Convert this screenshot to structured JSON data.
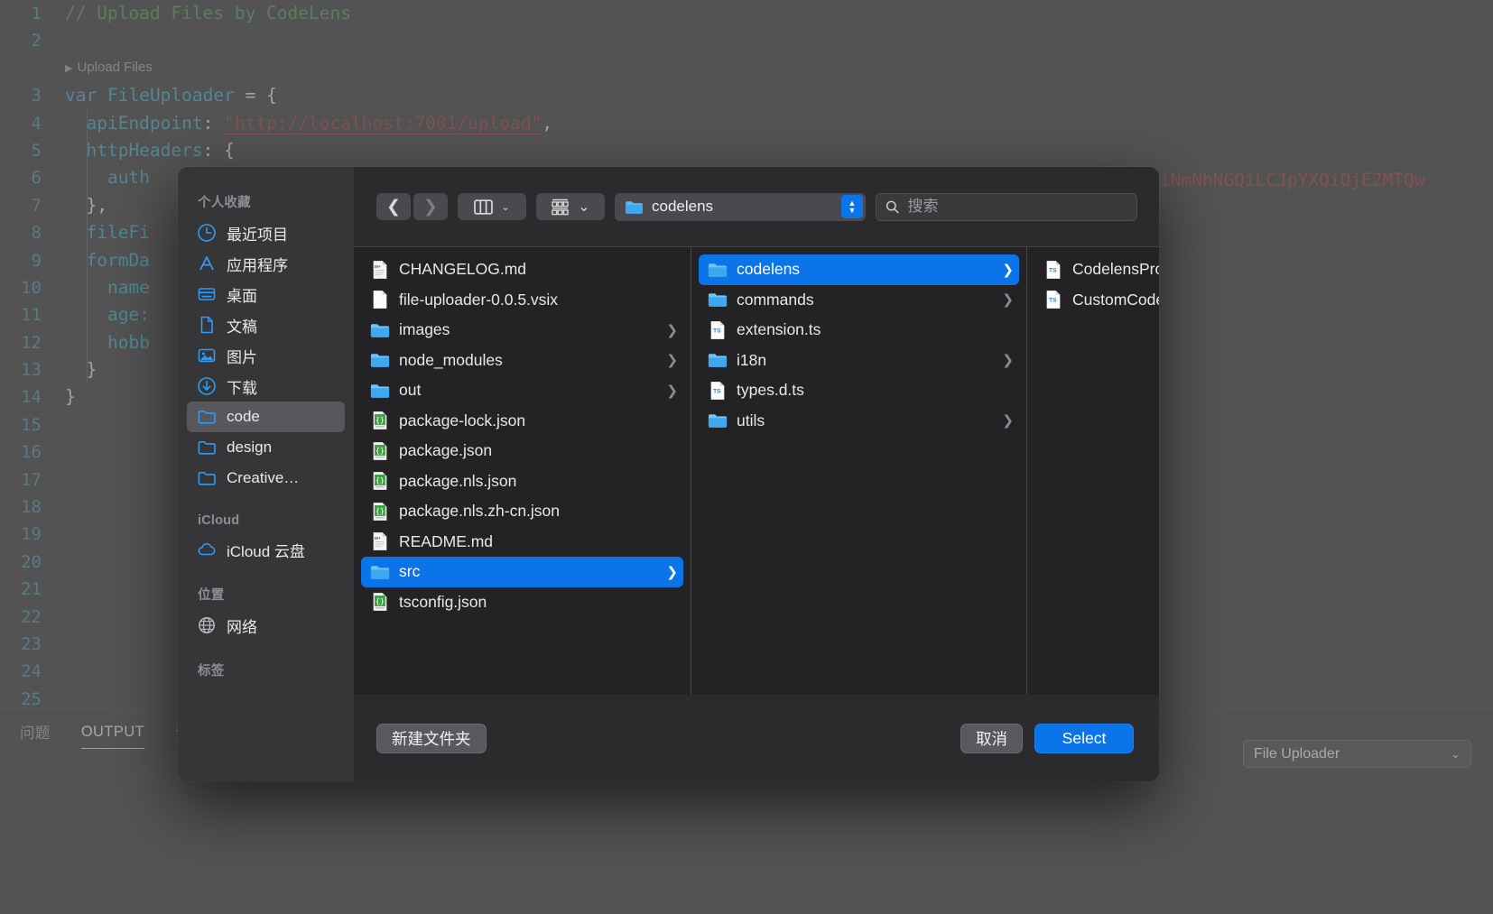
{
  "editor": {
    "lines": [
      {
        "num": "1",
        "kind": "comment",
        "text": "// Upload Files by CodeLens"
      },
      {
        "num": "2",
        "kind": "blank",
        "text": ""
      },
      {
        "num": "",
        "kind": "codelens",
        "text": "Upload Files"
      },
      {
        "num": "3",
        "kind": "code",
        "text": "var FileUploader = {"
      },
      {
        "num": "4",
        "kind": "code",
        "text": "  apiEndpoint: \"http://localhost:7001/upload\","
      },
      {
        "num": "5",
        "kind": "code",
        "text": "  httpHeaders: {"
      },
      {
        "num": "6",
        "kind": "code",
        "text": "    auth"
      },
      {
        "num": "7",
        "kind": "code",
        "text": "  },"
      },
      {
        "num": "8",
        "kind": "code",
        "text": "  fileFi"
      },
      {
        "num": "9",
        "kind": "code",
        "text": "  formDa"
      },
      {
        "num": "10",
        "kind": "code",
        "text": "    name"
      },
      {
        "num": "11",
        "kind": "code",
        "text": "    age:"
      },
      {
        "num": "12",
        "kind": "code",
        "text": "    hobb"
      },
      {
        "num": "13",
        "kind": "code",
        "text": "  }"
      },
      {
        "num": "14",
        "kind": "code",
        "text": "}"
      },
      {
        "num": "15",
        "kind": "blank",
        "text": ""
      },
      {
        "num": "16",
        "kind": "blank",
        "text": ""
      },
      {
        "num": "17",
        "kind": "blank",
        "text": ""
      },
      {
        "num": "18",
        "kind": "blank",
        "text": ""
      },
      {
        "num": "19",
        "kind": "blank",
        "text": ""
      },
      {
        "num": "20",
        "kind": "blank",
        "text": ""
      },
      {
        "num": "21",
        "kind": "blank",
        "text": ""
      },
      {
        "num": "22",
        "kind": "blank",
        "text": ""
      },
      {
        "num": "23",
        "kind": "blank",
        "text": ""
      },
      {
        "num": "24",
        "kind": "blank",
        "text": ""
      },
      {
        "num": "25",
        "kind": "blank",
        "text": ""
      }
    ],
    "codelens_label": "Upload Files",
    "comment_line": "// Upload Files by CodeLens",
    "line3": {
      "kw": "var",
      "name": "FileUploader",
      "rest": " = {"
    },
    "line4": {
      "prop": "  apiEndpoint",
      "sep": ": ",
      "value": "\"http://localhost:7001/upload\"",
      "tail": ","
    },
    "line5": {
      "prop": "  httpHeaders",
      "rest": ": {"
    },
    "line6": {
      "prop": "    auth"
    },
    "line7": {
      "rest": "  },"
    },
    "line8": {
      "prop": "  fileFi"
    },
    "line9": {
      "prop": "  formDa"
    },
    "line10": {
      "prop": "    name"
    },
    "line11": {
      "prop": "    age:"
    },
    "line12": {
      "prop": "    hobb"
    },
    "line13": {
      "rest": "  }"
    },
    "line14": {
      "rest": "}"
    },
    "overflow_string": "iNmNhNGQiLCJpYXQiOjE2MTQw"
  },
  "panel": {
    "tabs": [
      {
        "label": "问题",
        "active": false
      },
      {
        "label": "OUTPUT",
        "active": true
      },
      {
        "label": "调",
        "active": false
      }
    ],
    "output_channel": "File Uploader",
    "chevron": "⌄"
  },
  "dialog": {
    "sidebar": {
      "sections": [
        {
          "title": "个人收藏",
          "items": [
            {
              "label": "最近项目",
              "icon": "clock-icon",
              "selected": false
            },
            {
              "label": "应用程序",
              "icon": "apps-icon",
              "selected": false
            },
            {
              "label": "桌面",
              "icon": "desktop-icon",
              "selected": false
            },
            {
              "label": "文稿",
              "icon": "document-icon",
              "selected": false
            },
            {
              "label": "图片",
              "icon": "pictures-icon",
              "selected": false
            },
            {
              "label": "下载",
              "icon": "download-icon",
              "selected": false
            },
            {
              "label": "code",
              "icon": "folder-icon",
              "selected": true
            },
            {
              "label": "design",
              "icon": "folder-icon",
              "selected": false
            },
            {
              "label": "Creative…",
              "icon": "folder-icon",
              "selected": false
            }
          ]
        },
        {
          "title": "iCloud",
          "items": [
            {
              "label": "iCloud 云盘",
              "icon": "cloud-icon",
              "selected": false
            }
          ]
        },
        {
          "title": "位置",
          "items": [
            {
              "label": "网络",
              "icon": "globe-icon",
              "selected": false
            }
          ]
        },
        {
          "title": "标签",
          "items": []
        }
      ]
    },
    "toolbar": {
      "back_icon": "chevron-left-icon",
      "forward_icon": "chevron-right-icon",
      "view_icon": "column-view-icon",
      "group_icon": "group-by-icon",
      "caret": "⌄",
      "path_label": "codelens",
      "search_placeholder": "搜索",
      "search_value": ""
    },
    "columns": [
      {
        "items": [
          {
            "name": "CHANGELOG.md",
            "type": "md",
            "arrow": false,
            "selected": false
          },
          {
            "name": "file-uploader-0.0.5.vsix",
            "type": "file",
            "arrow": false,
            "selected": false
          },
          {
            "name": "images",
            "type": "folder",
            "arrow": true,
            "selected": false
          },
          {
            "name": "node_modules",
            "type": "folder",
            "arrow": true,
            "selected": false
          },
          {
            "name": "out",
            "type": "folder",
            "arrow": true,
            "selected": false
          },
          {
            "name": "package-lock.json",
            "type": "json",
            "arrow": false,
            "selected": false
          },
          {
            "name": "package.json",
            "type": "json",
            "arrow": false,
            "selected": false
          },
          {
            "name": "package.nls.json",
            "type": "json",
            "arrow": false,
            "selected": false
          },
          {
            "name": "package.nls.zh-cn.json",
            "type": "json",
            "arrow": false,
            "selected": false
          },
          {
            "name": "README.md",
            "type": "md",
            "arrow": false,
            "selected": false
          },
          {
            "name": "src",
            "type": "folder",
            "arrow": true,
            "selected": true
          },
          {
            "name": "tsconfig.json",
            "type": "json",
            "arrow": false,
            "selected": false
          }
        ]
      },
      {
        "items": [
          {
            "name": "codelens",
            "type": "folder",
            "arrow": true,
            "selected": true
          },
          {
            "name": "commands",
            "type": "folder",
            "arrow": true,
            "selected": false
          },
          {
            "name": "extension.ts",
            "type": "ts",
            "arrow": false,
            "selected": false
          },
          {
            "name": "i18n",
            "type": "folder",
            "arrow": true,
            "selected": false
          },
          {
            "name": "types.d.ts",
            "type": "ts",
            "arrow": false,
            "selected": false
          },
          {
            "name": "utils",
            "type": "folder",
            "arrow": true,
            "selected": false
          }
        ]
      },
      {
        "items": [
          {
            "name": "CodelensProvider.ts",
            "type": "ts",
            "arrow": false,
            "selected": false
          },
          {
            "name": "CustomCodelens.ts",
            "type": "ts",
            "arrow": false,
            "selected": false
          }
        ]
      }
    ],
    "footer": {
      "new_folder_label": "新建文件夹",
      "cancel_label": "取消",
      "select_label": "Select"
    }
  },
  "colors": {
    "accent_blue": "#0a74e8",
    "folder_blue": "#4eb3f0",
    "json_green": "#4caf50",
    "comment_green": "#2e7d32",
    "string_red": "#8b1a1a"
  }
}
